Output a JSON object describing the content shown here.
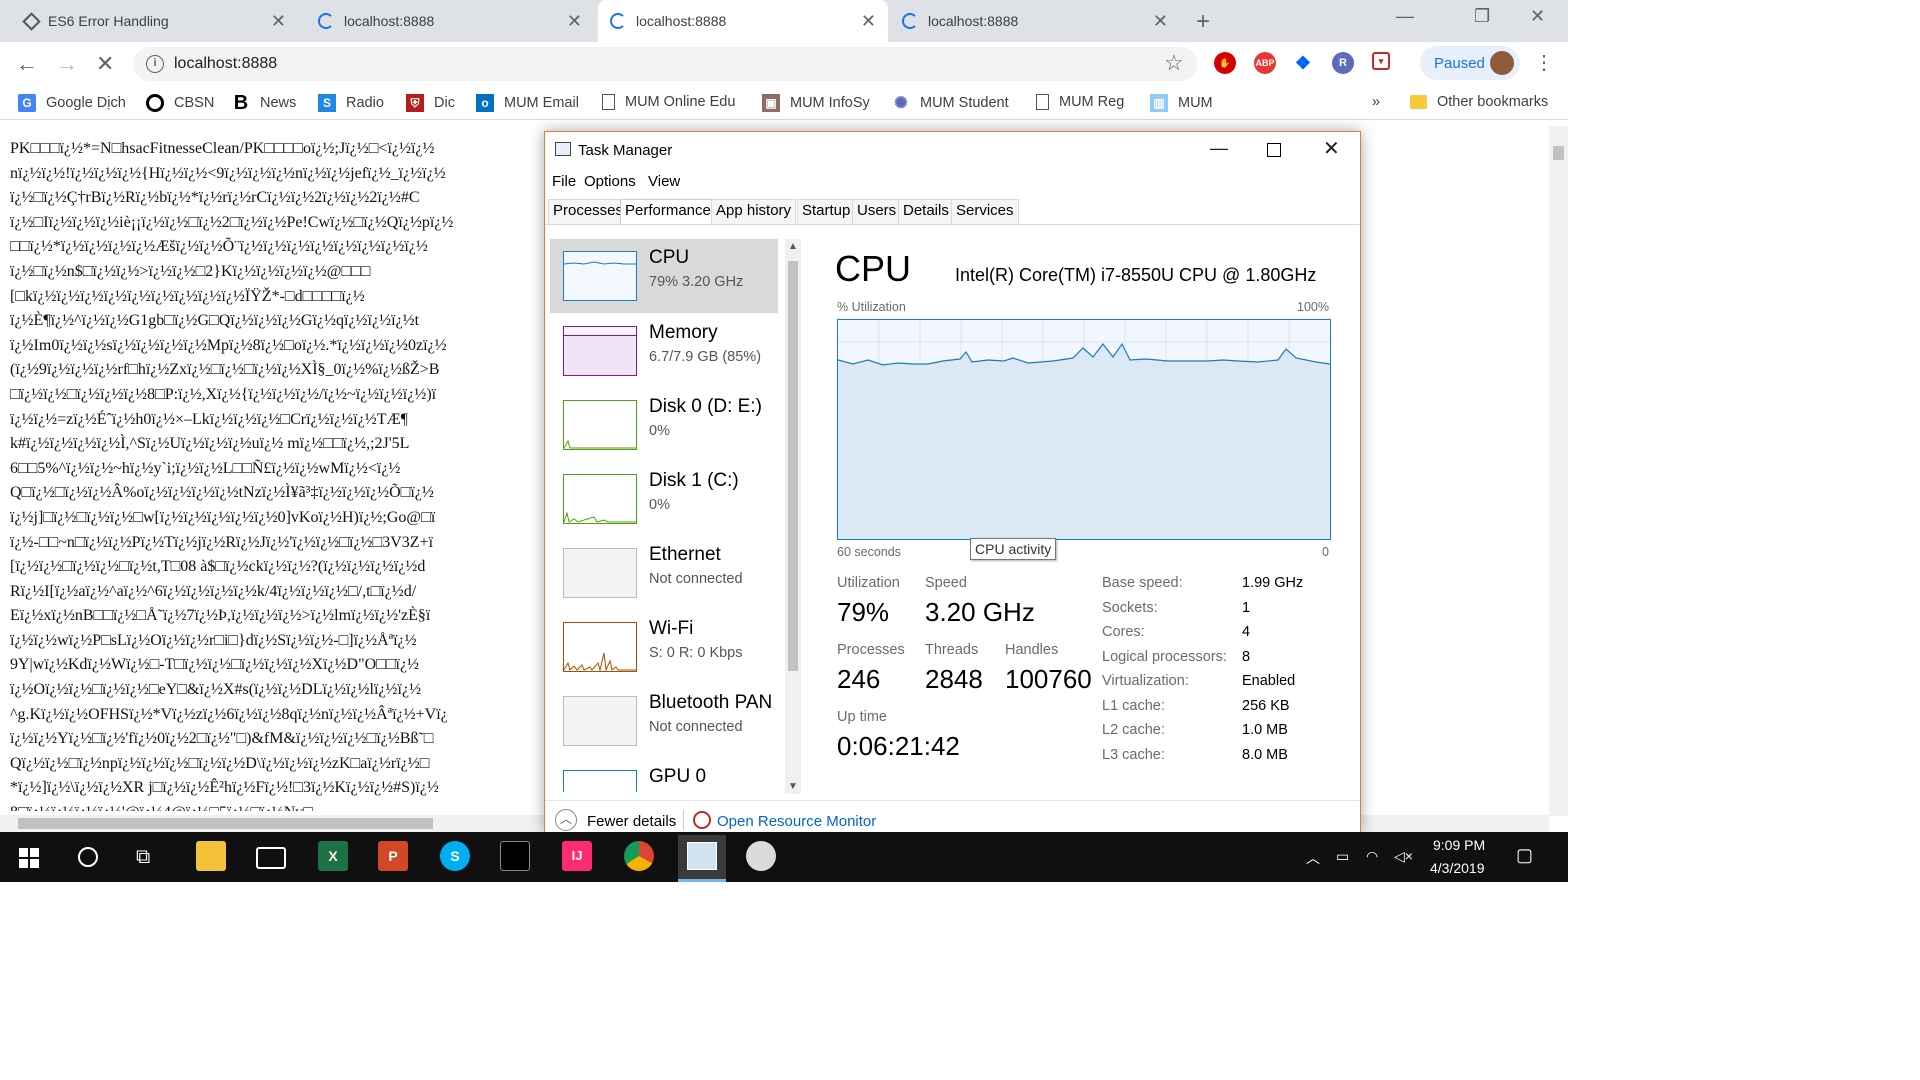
{
  "browser": {
    "tabs": [
      {
        "title": "ES6 Error Handling"
      },
      {
        "title": "localhost:8888"
      },
      {
        "title": "localhost:8888"
      },
      {
        "title": "localhost:8888"
      }
    ],
    "url": "localhost:8888",
    "profile_status": "Paused",
    "bookmarks": [
      {
        "label": "Google Dịch"
      },
      {
        "label": "CBSN"
      },
      {
        "label": "News"
      },
      {
        "label": "Radio"
      },
      {
        "label": "Dic"
      },
      {
        "label": "MUM Email"
      },
      {
        "label": "MUM Online Edu"
      },
      {
        "label": "MUM InfoSy"
      },
      {
        "label": "MUM Student"
      },
      {
        "label": "MUM Reg"
      },
      {
        "label": "MUM"
      }
    ],
    "bookmarks_overflow": "»",
    "other_bookmarks": "Other bookmarks",
    "extensions": [
      "ABP"
    ]
  },
  "page_text": "PK□□□ï¿½*=N□hsacFitnesseClean/PK□□□□oï¿½;Jï¿½□<ï¿½ï¿½                                                                                            ;,□ï¿½5□ ï¿½□ï¿½\nnï¿½ï¿½!ï¿½ï¿½ï¿½{Hï¿½ï¿½<9ï¿½ï¿½ï¿½nï¿½ï¿½jefï¿½_ï¿½ï¿½                                                                                            ï¿½ ï¿½eqï¿½ï¿½\nï¿½□ï¿½Ç†rBï¿½Rï¿½bï¿½*ï¿½rï¿½rCï¿½ï¿½2ï¿½ï¿½2ï¿½#C\nï¿½□Iï¿½ï¿½ï¿½iè¡¡ï¿½ï¿½□ï¿½2□ï¿½ï¿½Pe!Cwï¿½□ï¿½Qï¿½pï¿½\n□□ï¿½*ï¿½ï¿½ï¿½ï¿½Æšï¿½ï¿½Õ¨ï¿½ï¿½ï¿½ï¿½ï¿½ï¿½ï¿½ï¿½\nï¿½□ï¿½n$□ï¿½ï¿½>ï¿½ï¿½□2}Kï¿½ï¿½ï¿½ï¿½@□□□\n[□kï¿½ï¿½ï¿½ï¿½ï¿½ï¿½ï¿½ï¿½ï¿½ÏŸŽ*-□d□□□□ï¿½                                                                                            ï¿½dï¿½]□ï¿½ï¿½ï¿½[\nï¿½È¶ï¿½^ï¿½ï¿½G1gb□ï¿½G□Qï¿½ï¿½ï¿½Gï¿½qï¿½ï¿½ï¿½t                                                                                            ï¿½ï¿½ï¿½□WQ[□\nï¿½Im0ï¿½ï¿½sï¿½ï¿½ï¿½ï¿½Mpï¿½8ï¿½□oï¿½.*ï¿½ï¿½ï¿½0zï¿½                                                                                            □ï¿½□ï¿½ï¿½~\n(ï¿½9ï¿½ï¿½ï¿½rf□hï¿½Zxï¿½□ï¿½□ï¿½ï¿½XÌ§_0ï¿½%ï¿½ßŽ>B\n□ï¿½ï¿½□ï¿½ï¿½ï¿½8□P:ï¿½,Xï¿½{ï¿½ï¿½ï¿½/ï¿½~ï¿½ï¿½ï¿½)ï                                                                                            ï¿½@æŒ‰c6ï¿½\nï¿½ï¿½=zï¿½Éˆï¿½h0ï¿½×–Lkï¿½ï¿½ï¿½□Crï¿½ï¿½ï¿½TÆ¶                                                                                            ï¿½ï¿½□ï¿½L@ï¿½\nk#ï¿½ï¿½ï¿½ï¿½Ì,^Sï¿½Uï¿½ï¿½ï¿½uï¿½ mï¿½□□ï¿½,;2J'5L                                                                                            ï¿½Rlï¿½+ï¿½%Xc9H\n6□□5%^ï¿½ï¿½~hï¿½y`i;ï¿½ï¿½L□□Ñ£ï¿½ï¿½wMï¿½<ï¿½\nQ□ï¿½□ï¿½ï¿½Â%oï¿½ï¿½ï¿½ï¿½tNzï¿½Ì¥ã³‡ï¿½ï¿½ï¿½Õ□ï¿½\nï¿½j]□ï¿½□ï¿½ï¿½□w[ï¿½ï¿½ï¿½ï¿½ï¿½0]vKoï¿½H)ï¿½;Go@□ï                                                                                            gï¿½,ï¿½□ï¿½□}\nï¿½-□□~n□ï¿½ï¿½Pï¿½Tï¿½jï¿½Rï¿½Jï¿½'ï¿½ï¿½□ï¿½□3V3Z+ï\n[ï¿½ï¿½□ï¿½ï¿½□ï¿½t,T□08 à$□ï¿½ckï¿½ï¿½?(ï¿½ï¿½ï¿½ï¿½d\nRï¿½I[ï¿½aï¿½^aï¿½^6ï¿½ï¿½ï¿½ï¿½k/4ï¿½ï¿½ï¿½□/,t□ï¿½d/                                                                                            ï¿½r'ï¿½Pï¿½Ä–\nEï¿½xï¿½nB□□ï¿½□Å˜ï¿½7ï¿½Þ,ï¿½ï¿½ï¿½>ï¿½lmï¿½ï¿½'zÈ§ï                                                                                            qï¿½}ï¿½[ï¿½\nï¿½ï¿½wï¿½P□sLï¿½Oï¿½ï¿½r□i□}dï¿½Sï¿½ï¿½-□]ï¿½Åªï¿½\n9Y|wï¿½Kdï¿½Wï¿½□-T□ï¿½ï¿½□ï¿½ï¿½ï¿½Xï¿½D\"O□□ï¿½\nï¿½Oï¿½ï¿½□ï¿½ï¿½□eY□&ï¿½X#s(ï¿½ï¿½DLï¿½ï¿½lï¿½ï¿½\n^g.Kï¿½ï¿½OFHSï¿½*Vï¿½zï¿½6ï¿½ï¿½8qï¿½nï¿½ï¿½Âªï¿½+Vï¿\nï¿½ï¿½Yï¿½□ï¿½'fï¿½0ï¿½2□ï¿½\"□)&fM&ï¿½ï¿½ï¿½□ï¿½Bß˜□\nQï¿½ï¿½□ï¿½npï¿½ï¿½ï¿½□ï¿½ï¿½D\\ï¿½ï¿½ï¿½zK□aï¿½rï¿½□\n*ï¿½]ï¿½\\ï¿½ï¿½XR j□ï¿½ï¿½Ê²hï¿½Fï¿½!□3ï¿½Kï¿½ï¿½#S)ï¿½\n8□ï¿½ï¿½ï¿½ï¿½'@ï¿½4@ï¿½□5ï¿½□ï¿½Nv□\nï¿½Ì¶dï¿½ï¿½'mï¿½ï¿½□É¯=ï¿½□rï¿½:ï¿½$ï¿½□[>ï¿½ï¿½Ç¤F9□^ï                                                                                            ï¿½ï¿½□□@RAi&!\nï¿½zï¿½ï¿½ï¿½ï¿½(ï¿½ï¿½Ä f□ï¿½ï¿½Hfï¿½[",
  "task_manager": {
    "title": "Task Manager",
    "menu": [
      "File",
      "Options",
      "View"
    ],
    "tabs": [
      "Processes",
      "Performance",
      "App history",
      "Startup",
      "Users",
      "Details",
      "Services"
    ],
    "sidebar": [
      {
        "name": "CPU",
        "sub": "79%  3.20 GHz"
      },
      {
        "name": "Memory",
        "sub": "6.7/7.9 GB (85%)"
      },
      {
        "name": "Disk 0 (D: E:)",
        "sub": "0%"
      },
      {
        "name": "Disk 1 (C:)",
        "sub": "0%"
      },
      {
        "name": "Ethernet",
        "sub": "Not connected"
      },
      {
        "name": "Wi-Fi",
        "sub": "S: 0 R: 0 Kbps"
      },
      {
        "name": "Bluetooth PAN",
        "sub": "Not connected"
      },
      {
        "name": "GPU 0",
        "sub": ""
      }
    ],
    "cpu_title": "CPU",
    "cpu_model": "Intel(R) Core(TM) i7-8550U CPU @ 1.80GHz",
    "graph_label_left": "% Utilization",
    "graph_label_right": "100%",
    "graph_bottom_left": "60 seconds",
    "graph_bottom_right": "0",
    "tooltip": "CPU activity",
    "stats": {
      "utilization_label": "Utilization",
      "utilization": "79%",
      "speed_label": "Speed",
      "speed": "3.20 GHz",
      "processes_label": "Processes",
      "processes": "246",
      "threads_label": "Threads",
      "threads": "2848",
      "handles_label": "Handles",
      "handles": "100760",
      "uptime_label": "Up time",
      "uptime": "0:06:21:42"
    },
    "specs": [
      {
        "k": "Base speed:",
        "v": "1.99 GHz"
      },
      {
        "k": "Sockets:",
        "v": "1"
      },
      {
        "k": "Cores:",
        "v": "4"
      },
      {
        "k": "Logical processors:",
        "v": "8"
      },
      {
        "k": "Virtualization:",
        "v": "Enabled"
      },
      {
        "k": "L1 cache:",
        "v": "256 KB"
      },
      {
        "k": "L2 cache:",
        "v": "1.0 MB"
      },
      {
        "k": "L3 cache:",
        "v": "8.0 MB"
      }
    ],
    "footer_fewer": "Fewer details",
    "footer_monitor": "Open Resource Monitor",
    "colors": {
      "cpu": "#1a7bbd",
      "memory": "#8b12ae",
      "disk": "#4da60c",
      "wifi": "#a74f01"
    }
  },
  "taskbar": {
    "time": "9:09 PM",
    "date": "4/3/2019"
  }
}
